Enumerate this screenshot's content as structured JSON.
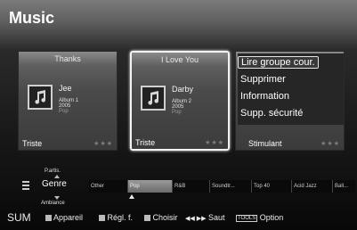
{
  "page": {
    "title": "Music"
  },
  "cards": [
    {
      "song": "Thanks",
      "artist": "Jee",
      "album": "Album 1",
      "year": "2005",
      "genre": "Pop",
      "mood": "Triste",
      "stars": "★★★",
      "selected": false
    },
    {
      "song": "I Love You",
      "artist": "Darby",
      "album": "Album 2",
      "year": "2005",
      "genre": "Pop",
      "mood": "Triste",
      "stars": "★★★",
      "selected": true
    }
  ],
  "menu": {
    "items": [
      "Lire groupe cour.",
      "Supprimer",
      "Information",
      "Supp. sécurité"
    ],
    "highlighted_index": 0,
    "mood": "Stimulant",
    "stars": "★★★"
  },
  "sort": {
    "prev_label": "P.artis.",
    "current_label": "Genre",
    "next_label": "Ambiance"
  },
  "genres": [
    "Other",
    "Pop",
    "R&B",
    "Soundtr...",
    "Top 40",
    "Acid Jazz",
    "Ball..."
  ],
  "selected_genre_index": 1,
  "footer": {
    "source": "SUM",
    "device": "Appareil",
    "settings": "Régl. f.",
    "select": "Choisir",
    "skip_symbol": "◀◀ ▶▶",
    "skip": "Saut",
    "tools_key": "TOOLS",
    "option": "Option"
  }
}
